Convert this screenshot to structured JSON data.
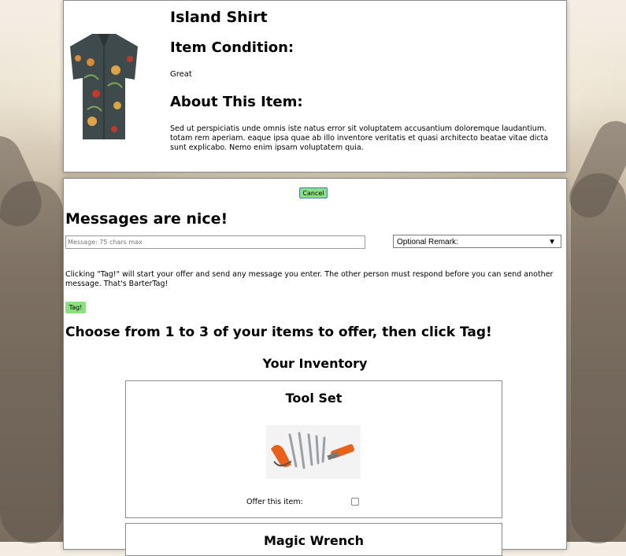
{
  "item": {
    "title": "Island Shirt",
    "condition_heading": "Item Condition:",
    "condition_value": "Great",
    "about_heading": "About This Item:",
    "about_text": "Sed ut perspiciatis unde omnis iste natus error sit voluptatem accusantium doloremque laudantium. totam rem aperiam. eaque ipsa quae ab illo inventore veritatis et quasi architecto beatae vitae dicta sunt explicabo. Nemo enim ipsam voluptatem quia."
  },
  "offer": {
    "cancel_label": "Cancel",
    "messages_heading": "Messages are nice!",
    "message_placeholder": "Message: 75 chars max",
    "remark_selected": "Optional Remark:",
    "info_text": "Clicking \"Tag!\" will start your offer and send any message you enter. The other person must respond before you can send another message. That's BarterTag!",
    "tag_label": "Tag!",
    "choose_heading": "Choose from 1 to 3 of your items to offer, then click Tag!",
    "inventory_heading": "Your Inventory",
    "inventory": [
      {
        "name": "Tool Set",
        "offer_label": "Offer this item:",
        "image": "tool-set-image"
      },
      {
        "name": "Magic Wrench"
      }
    ]
  },
  "colors": {
    "button_green": "#8be07f",
    "focus_blue": "#3a7bd5"
  }
}
